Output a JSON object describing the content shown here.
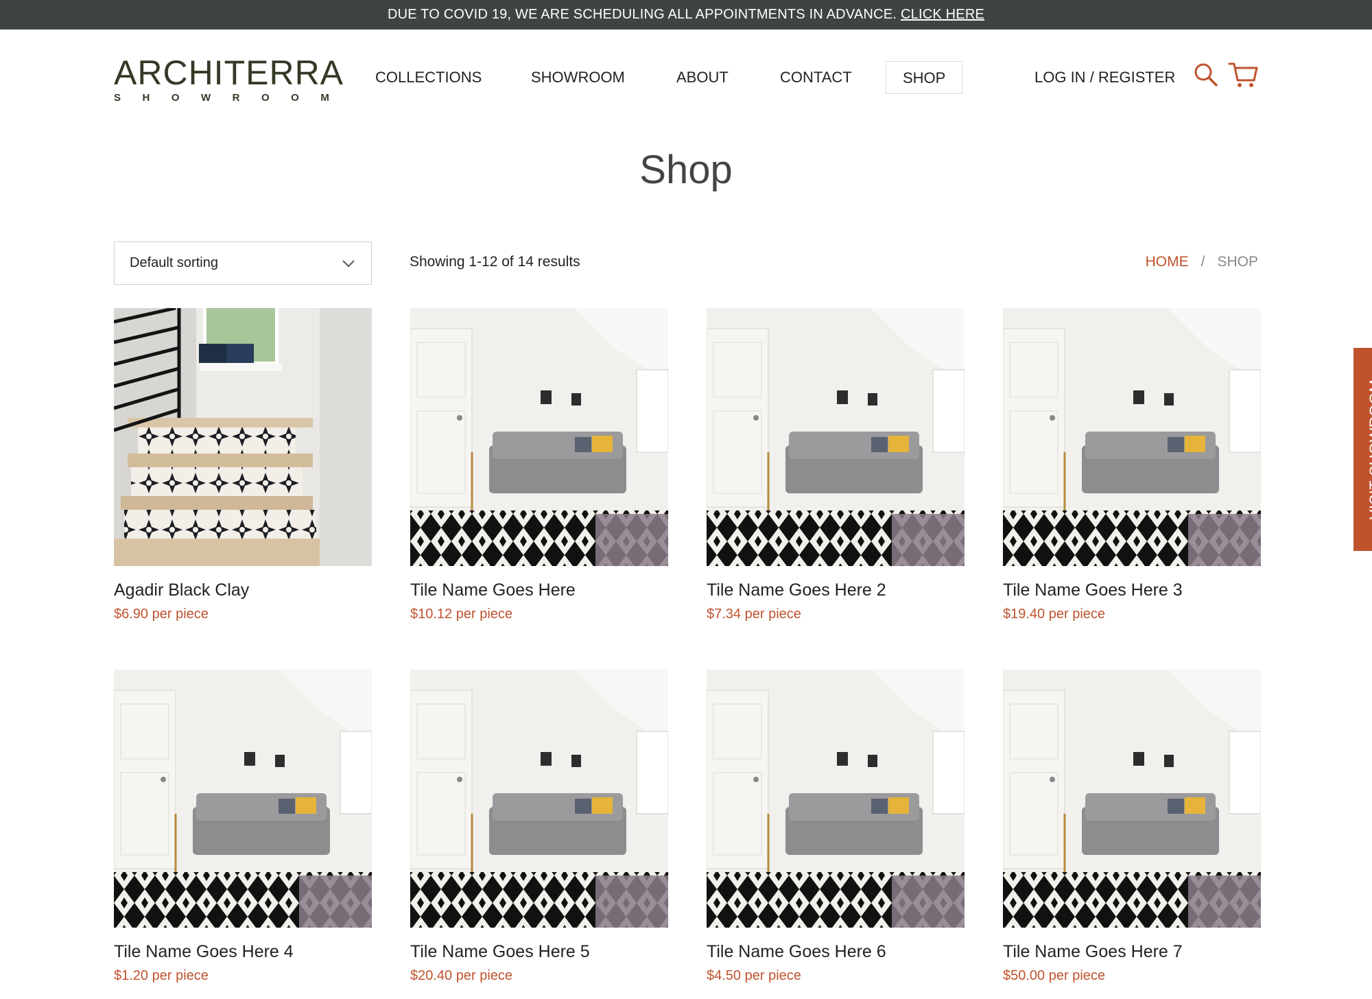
{
  "announcement": {
    "text": "DUE TO COVID 19, WE ARE SCHEDULING ALL APPOINTMENTS IN ADVANCE.",
    "link_label": "CLICK HERE"
  },
  "brand": {
    "name": "ARCHITERRA",
    "tagline": "SHOWROOM"
  },
  "nav": {
    "items": [
      {
        "label": "COLLECTIONS",
        "active": false
      },
      {
        "label": "SHOWROOM",
        "active": false
      },
      {
        "label": "ABOUT",
        "active": false
      },
      {
        "label": "CONTACT",
        "active": false
      },
      {
        "label": "SHOP",
        "active": true
      }
    ],
    "auth_label": "LOG IN / REGISTER",
    "icons": [
      "search-icon",
      "cart-icon"
    ]
  },
  "page": {
    "title": "Shop"
  },
  "toolbar": {
    "sort_selected": "Default sorting",
    "results_text": "Showing 1-12 of 14 results"
  },
  "breadcrumb": {
    "home": "HOME",
    "separator": "/",
    "current": "SHOP"
  },
  "products": [
    {
      "name": "Agadir Black Clay",
      "price": "$6.90 per piece",
      "image": "stair-tiles"
    },
    {
      "name": "Tile Name Goes Here",
      "price": "$10.12 per piece",
      "image": "living-room"
    },
    {
      "name": "Tile Name Goes Here 2",
      "price": "$7.34 per piece",
      "image": "living-room"
    },
    {
      "name": "Tile Name Goes Here 3",
      "price": "$19.40 per piece",
      "image": "living-room"
    },
    {
      "name": "Tile Name Goes Here 4",
      "price": "$1.20 per piece",
      "image": "living-room"
    },
    {
      "name": "Tile Name Goes Here 5",
      "price": "$20.40 per piece",
      "image": "living-room"
    },
    {
      "name": "Tile Name Goes Here 6",
      "price": "$4.50 per piece",
      "image": "living-room"
    },
    {
      "name": "Tile Name Goes Here 7",
      "price": "$50.00 per piece",
      "image": "living-room"
    }
  ],
  "side_tab": {
    "label": "VISIT SHOWROOM"
  },
  "colors": {
    "accent": "#c0532e",
    "announcement_bg": "#3e4540",
    "brand": "#333a26"
  }
}
